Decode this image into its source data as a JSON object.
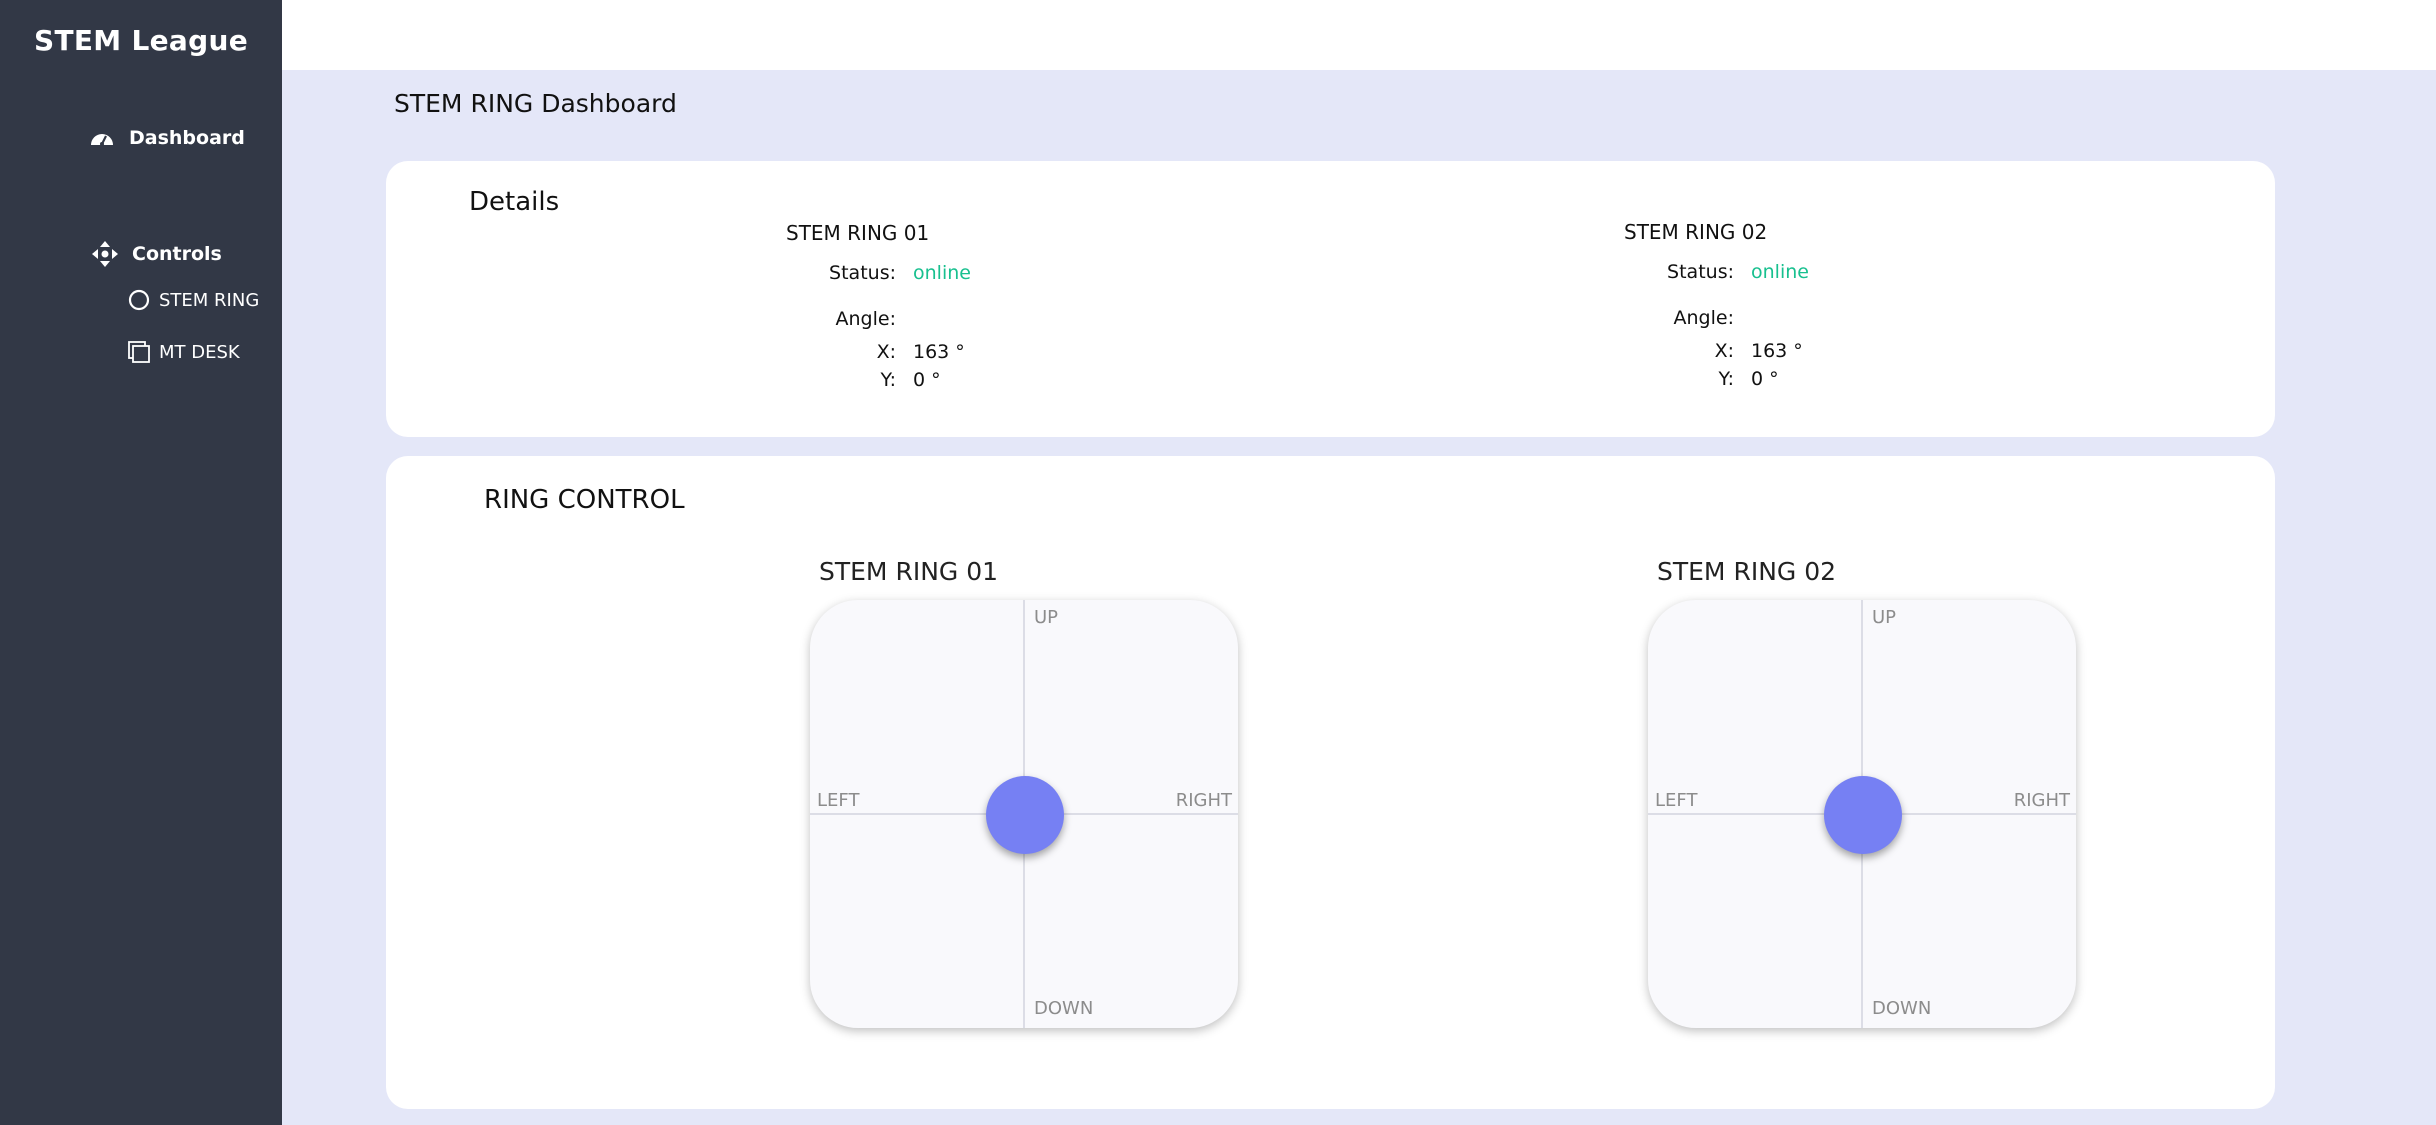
{
  "sidebar": {
    "brand": "STEM League",
    "items": [
      {
        "label": "Dashboard",
        "icon": "gauge-icon"
      },
      {
        "label": "Controls",
        "icon": "move-arrows-icon",
        "children": [
          {
            "label": "STEM RING",
            "icon": "circle-icon"
          },
          {
            "label": "MT DESK",
            "icon": "window-stack-icon"
          }
        ]
      }
    ]
  },
  "page": {
    "title": "STEM RING Dashboard"
  },
  "details": {
    "title": "Details",
    "labels": {
      "status": "Status:",
      "angle": "Angle:",
      "x": "X:",
      "y": "Y:"
    },
    "rings": [
      {
        "name": "STEM RING 01",
        "status": "online",
        "x": "163 °",
        "y": "0 °"
      },
      {
        "name": "STEM RING 02",
        "status": "online",
        "x": "163 °",
        "y": "0 °"
      }
    ]
  },
  "control": {
    "title": "RING CONTROL",
    "directions": {
      "up": "UP",
      "down": "DOWN",
      "left": "LEFT",
      "right": "RIGHT"
    },
    "pads": [
      {
        "name": "STEM RING 01"
      },
      {
        "name": "STEM RING 02"
      }
    ]
  },
  "colors": {
    "sidebar": "#323846",
    "background": "#e4e7f8",
    "online": "#18c08f",
    "knob": "#7680f3"
  }
}
